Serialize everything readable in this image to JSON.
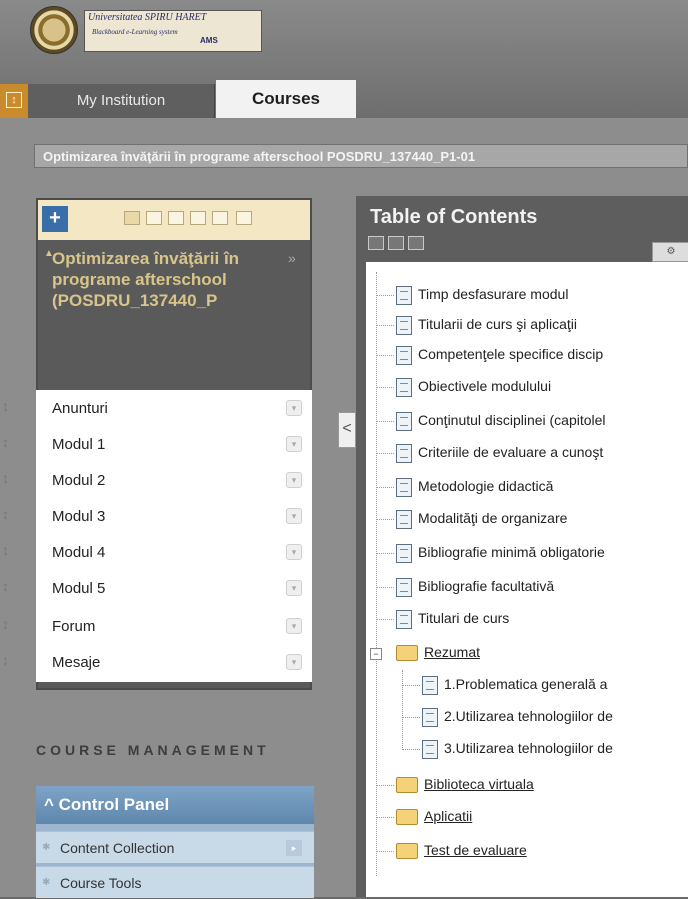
{
  "header": {
    "logo_line1": "Universitatea SPIRU HARET",
    "logo_line2": "Blackboard e-Learning system",
    "logo_line3": "AMS"
  },
  "tabs": {
    "my_institution": "My Institution",
    "courses": "Courses"
  },
  "breadcrumb": "Optimizarea învăţării în programe afterschool POSDRU_137440_P1-01",
  "course_menu": {
    "add_label": "+",
    "title": "Optimizarea învăţării în programe afterschool (POSDRU_137440_P",
    "collapse": "»",
    "items": [
      {
        "label": "Anunturi"
      },
      {
        "label": "Modul 1"
      },
      {
        "label": "Modul 2"
      },
      {
        "label": "Modul 3"
      },
      {
        "label": "Modul 4"
      },
      {
        "label": "Modul 5"
      },
      {
        "label": "Forum"
      },
      {
        "label": "Mesaje"
      }
    ]
  },
  "splitter_label": "<",
  "course_management": {
    "title": "COURSE MANAGEMENT",
    "control_panel": "Control Panel",
    "items": [
      {
        "label": "Content Collection"
      },
      {
        "label": "Course Tools"
      }
    ]
  },
  "toc": {
    "title": "Table of Contents",
    "items": [
      {
        "label": "Timp desfasurare modul",
        "type": "doc"
      },
      {
        "label": "Titularii de curs şi aplicaţii",
        "type": "doc"
      },
      {
        "label": "Competenţele specifice discip",
        "type": "doc"
      },
      {
        "label": "Obiectivele modulului",
        "type": "doc"
      },
      {
        "label": "Conţinutul disciplinei (capitolel",
        "type": "doc"
      },
      {
        "label": "Criteriile de evaluare a cunoşt",
        "type": "doc"
      },
      {
        "label": "Metodologie didactică",
        "type": "doc"
      },
      {
        "label": "Modalităţi de organizare",
        "type": "doc"
      },
      {
        "label": "Bibliografie minimă obligatorie",
        "type": "doc"
      },
      {
        "label": "Bibliografie facultativă",
        "type": "doc"
      },
      {
        "label": "Titulari de curs",
        "type": "doc"
      },
      {
        "label": "Rezumat",
        "type": "folder"
      }
    ],
    "sub_items": [
      {
        "label": "1.Problematica generală a"
      },
      {
        "label": "2.Utilizarea tehnologiilor de"
      },
      {
        "label": "3.Utilizarea tehnologiilor de"
      }
    ],
    "folders": [
      {
        "label": "Biblioteca virtuala"
      },
      {
        "label": "Aplicatii"
      },
      {
        "label": "Test de evaluare"
      }
    ]
  }
}
